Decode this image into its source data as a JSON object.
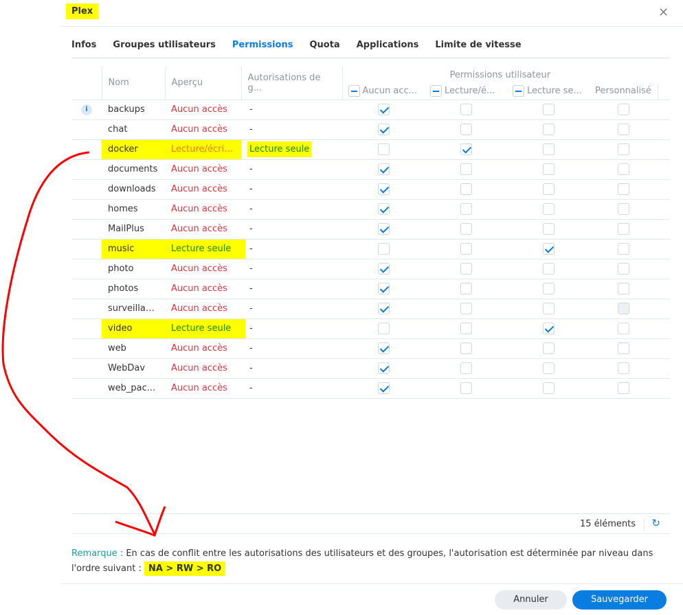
{
  "title": "Plex",
  "tabs": [
    "Infos",
    "Groupes utilisateurs",
    "Permissions",
    "Quota",
    "Applications",
    "Limite de vitesse"
  ],
  "active_tab": "Permissions",
  "columns": {
    "name": "Nom",
    "preview": "Aperçu",
    "group": "Autorisations de g...",
    "user_group": "Permissions utilisateur",
    "na": "Aucun acc...",
    "rw": "Lecture/é...",
    "ro": "Lecture se...",
    "custom": "Personnalisé"
  },
  "rows": [
    {
      "name": "backups",
      "preview": "Aucun accès",
      "pc": "red",
      "group": "-",
      "perm": "na",
      "info": true
    },
    {
      "name": "chat",
      "preview": "Aucun accès",
      "pc": "red",
      "group": "-",
      "perm": "na"
    },
    {
      "name": "docker",
      "preview": "Lecture/écriture",
      "pc": "orange",
      "group": "Lecture seule",
      "perm": "rw",
      "hl": true
    },
    {
      "name": "documents",
      "preview": "Aucun accès",
      "pc": "red",
      "group": "-",
      "perm": "na"
    },
    {
      "name": "downloads",
      "preview": "Aucun accès",
      "pc": "red",
      "group": "-",
      "perm": "na"
    },
    {
      "name": "homes",
      "preview": "Aucun accès",
      "pc": "red",
      "group": "-",
      "perm": "na"
    },
    {
      "name": "MailPlus",
      "preview": "Aucun accès",
      "pc": "red",
      "group": "-",
      "perm": "na"
    },
    {
      "name": "music",
      "preview": "Lecture seule",
      "pc": "green",
      "group": "-",
      "perm": "ro",
      "hl": true
    },
    {
      "name": "photo",
      "preview": "Aucun accès",
      "pc": "red",
      "group": "-",
      "perm": "na"
    },
    {
      "name": "photos",
      "preview": "Aucun accès",
      "pc": "red",
      "group": "-",
      "perm": "na"
    },
    {
      "name": "surveillan...",
      "preview": "Aucun accès",
      "pc": "red",
      "group": "-",
      "perm": "na",
      "custom_disabled": true
    },
    {
      "name": "video",
      "preview": "Lecture seule",
      "pc": "green",
      "group": "-",
      "perm": "ro",
      "hl": true
    },
    {
      "name": "web",
      "preview": "Aucun accès",
      "pc": "red",
      "group": "-",
      "perm": "na"
    },
    {
      "name": "WebDav",
      "preview": "Aucun accès",
      "pc": "red",
      "group": "-",
      "perm": "na"
    },
    {
      "name": "web_pac...",
      "preview": "Aucun accès",
      "pc": "red",
      "group": "-",
      "perm": "na"
    }
  ],
  "footer": {
    "count": "15 éléments"
  },
  "remark": {
    "label": "Remarque :",
    "text": " En cas de conflit entre les autorisations des utilisateurs et des groupes, l'autorisation est déterminée par niveau dans l'ordre suivant : ",
    "order": "NA > RW > RO"
  },
  "buttons": {
    "cancel": "Annuler",
    "save": "Sauvegarder"
  },
  "colors": {
    "accent": "#0a7de0",
    "annotation": "#ff0000",
    "highlight": "#ffff00"
  }
}
